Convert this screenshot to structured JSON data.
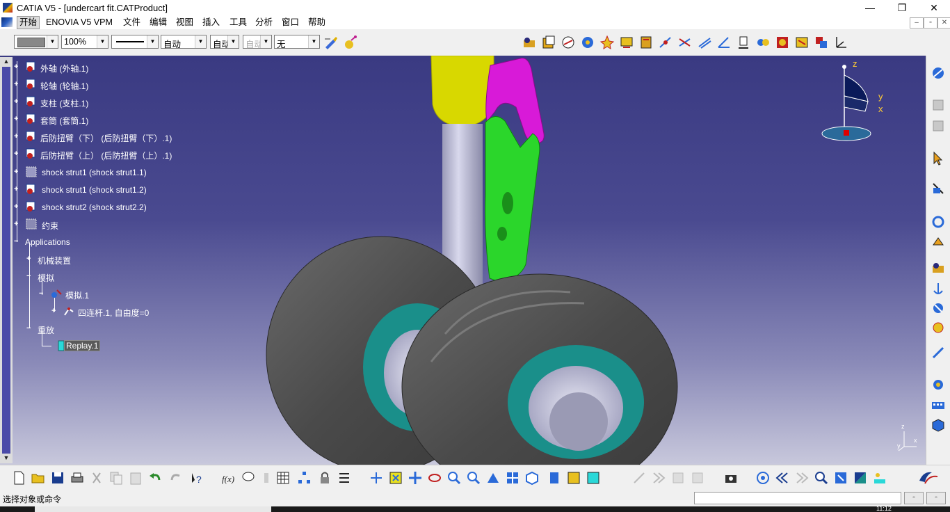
{
  "window": {
    "title": "CATIA V5 - [undercart fit.CATProduct]",
    "minimize": "—",
    "restore": "❐",
    "close": "✕"
  },
  "menu": {
    "items": [
      "开始",
      "ENOVIA V5 VPM",
      "文件",
      "编辑",
      "视图",
      "插入",
      "工具",
      "分析",
      "窗口",
      "帮助"
    ]
  },
  "mdi_controls": [
    "–",
    "▫",
    "✕"
  ],
  "toolbar_top": {
    "zoom": "100%",
    "line_type": "自动",
    "thickness": "自动",
    "disabled_combo": "自动",
    "layer": "无"
  },
  "tree": {
    "items": [
      {
        "label": "外轴 (外轴.1)"
      },
      {
        "label": "轮轴 (轮轴.1)"
      },
      {
        "label": "支柱 (支柱.1)"
      },
      {
        "label": "套筒 (套筒.1)"
      },
      {
        "label": "后防扭臂（下） (后防扭臂（下）.1)"
      },
      {
        "label": "后防扭臂（上） (后防扭臂（上）.1)"
      },
      {
        "label": "shock strut1 (shock strut1.1)"
      },
      {
        "label": "shock strut1 (shock strut1.2)"
      },
      {
        "label": "shock strut2 (shock strut2.2)"
      },
      {
        "label": "约束"
      }
    ],
    "applications": "Applications",
    "mechanical": "机械装置",
    "simulation": "模拟",
    "simulation_1": "模拟.1",
    "mechanism": "四连杆.1, 自由度=0",
    "replay": "重放",
    "replay_1": "Replay.1"
  },
  "compass": {
    "z": "z",
    "y": "y",
    "x": "x"
  },
  "axis_small": {
    "z": "z",
    "x": "x",
    "y": "y"
  },
  "status": {
    "message": "选择对象或命令",
    "command_value": "",
    "clock": "11:12"
  },
  "colors": {
    "viewport_top": "#3a3a82",
    "viewport_bottom": "#c8c8dc",
    "tire": "#5a5a5a",
    "hub_teal": "#1a8f8a",
    "strut": "#b8b8d0",
    "link_green": "#2bd62b",
    "link_magenta": "#d81ad8",
    "sleeve_yellow": "#d8d800"
  }
}
